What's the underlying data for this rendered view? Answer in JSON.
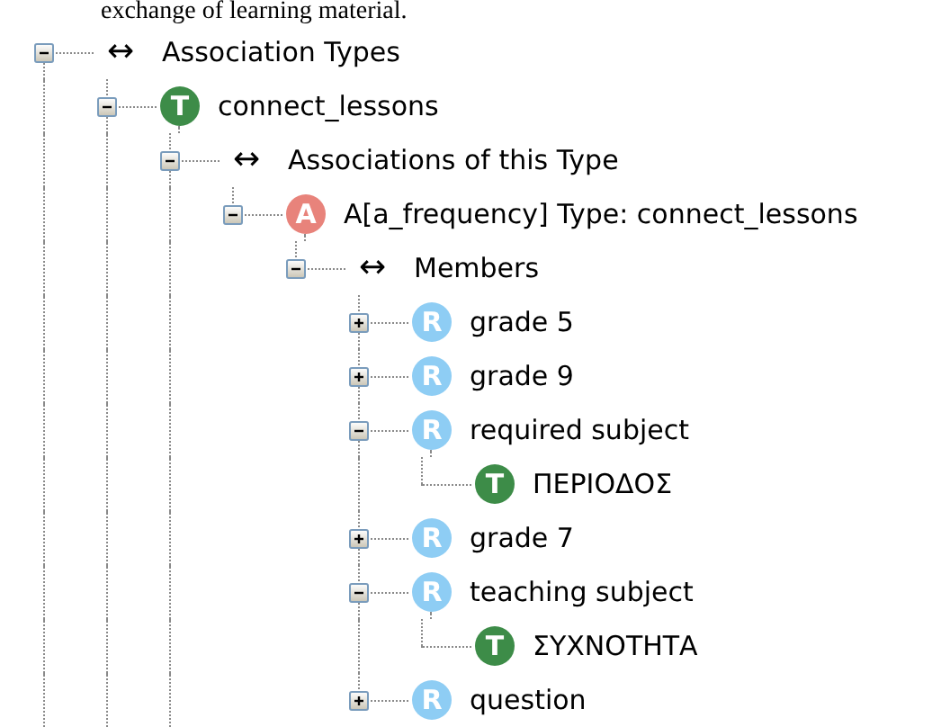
{
  "document_text": "exchange of learning material.",
  "tree": [
    {
      "kind": "group",
      "badge": "↔",
      "label": "Association Types",
      "expanded": true,
      "continues": true,
      "children": [
        {
          "kind": "topic",
          "badge": "T",
          "label": "connect_lessons",
          "expanded": true,
          "continues": true,
          "children": [
            {
              "kind": "group",
              "badge": "↔",
              "label": "Associations of this Type",
              "expanded": true,
              "continues": true,
              "children": [
                {
                  "kind": "association",
                  "badge": "A",
                  "label": "A[a_frequency] Type: connect_lessons",
                  "expanded": true,
                  "children": [
                    {
                      "kind": "group",
                      "badge": "↔",
                      "label": "Members",
                      "expanded": true,
                      "children": [
                        {
                          "kind": "role",
                          "badge": "R",
                          "label": "grade 5",
                          "expanded": false
                        },
                        {
                          "kind": "role",
                          "badge": "R",
                          "label": "grade 9",
                          "expanded": false
                        },
                        {
                          "kind": "role",
                          "badge": "R",
                          "label": "required subject",
                          "expanded": true,
                          "children": [
                            {
                              "kind": "topic",
                              "badge": "T",
                              "label": "ΠΕΡΙΟΔΟΣ"
                            }
                          ]
                        },
                        {
                          "kind": "role",
                          "badge": "R",
                          "label": "grade 7",
                          "expanded": false
                        },
                        {
                          "kind": "role",
                          "badge": "R",
                          "label": "teaching subject",
                          "expanded": true,
                          "children": [
                            {
                              "kind": "topic",
                              "badge": "T",
                              "label": "ΣΥΧΝΟΤΗΤΑ"
                            }
                          ]
                        },
                        {
                          "kind": "role",
                          "badge": "R",
                          "label": "question",
                          "expanded": false
                        }
                      ]
                    }
                  ]
                }
              ]
            }
          ]
        }
      ]
    }
  ]
}
